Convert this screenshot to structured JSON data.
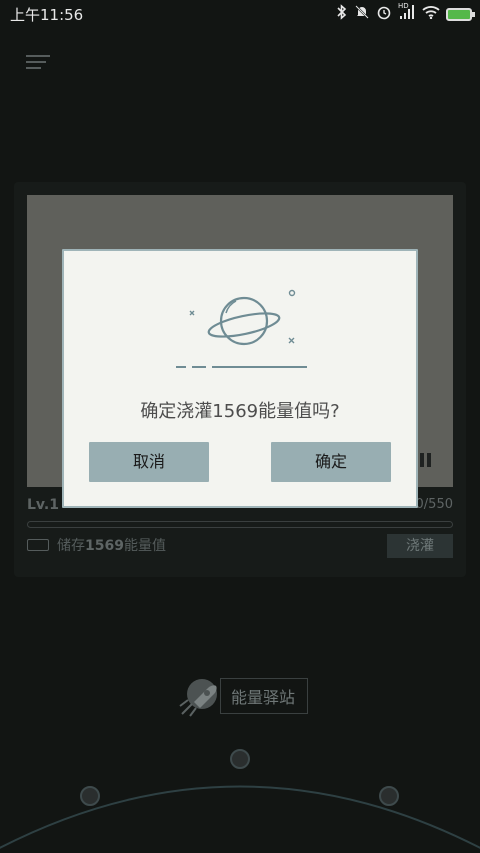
{
  "status_bar": {
    "time": "上午11:56",
    "signal_text": "HD"
  },
  "card": {
    "level": "Lv.1",
    "progress_text": "0/550",
    "progress_fraction": 0,
    "store_prefix": "储存",
    "store_amount": "1569",
    "store_suffix": "能量值",
    "water_button": "浇灌"
  },
  "dialog": {
    "message": "确定浇灌1569能量值吗?",
    "cancel_label": "取消",
    "confirm_label": "确定"
  },
  "station": {
    "label": "能量驿站"
  },
  "colors": {
    "accent": "#98aeb2",
    "background": "#121513",
    "dialog_bg": "#f3f4f0"
  }
}
